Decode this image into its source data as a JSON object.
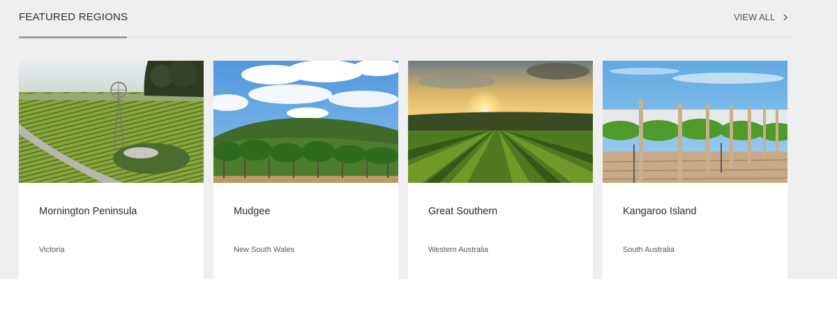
{
  "section": {
    "title": "FEATURED REGIONS",
    "view_all_label": "VIEW ALL"
  },
  "icons": {
    "view_all": "chevron-right-icon"
  },
  "cards": [
    {
      "name": "Mornington Peninsula",
      "state": "Victoria"
    },
    {
      "name": "Mudgee",
      "state": "New South Wales"
    },
    {
      "name": "Great Southern",
      "state": "Western Australia"
    },
    {
      "name": "Kangaroo Island",
      "state": "South Australia"
    }
  ]
}
